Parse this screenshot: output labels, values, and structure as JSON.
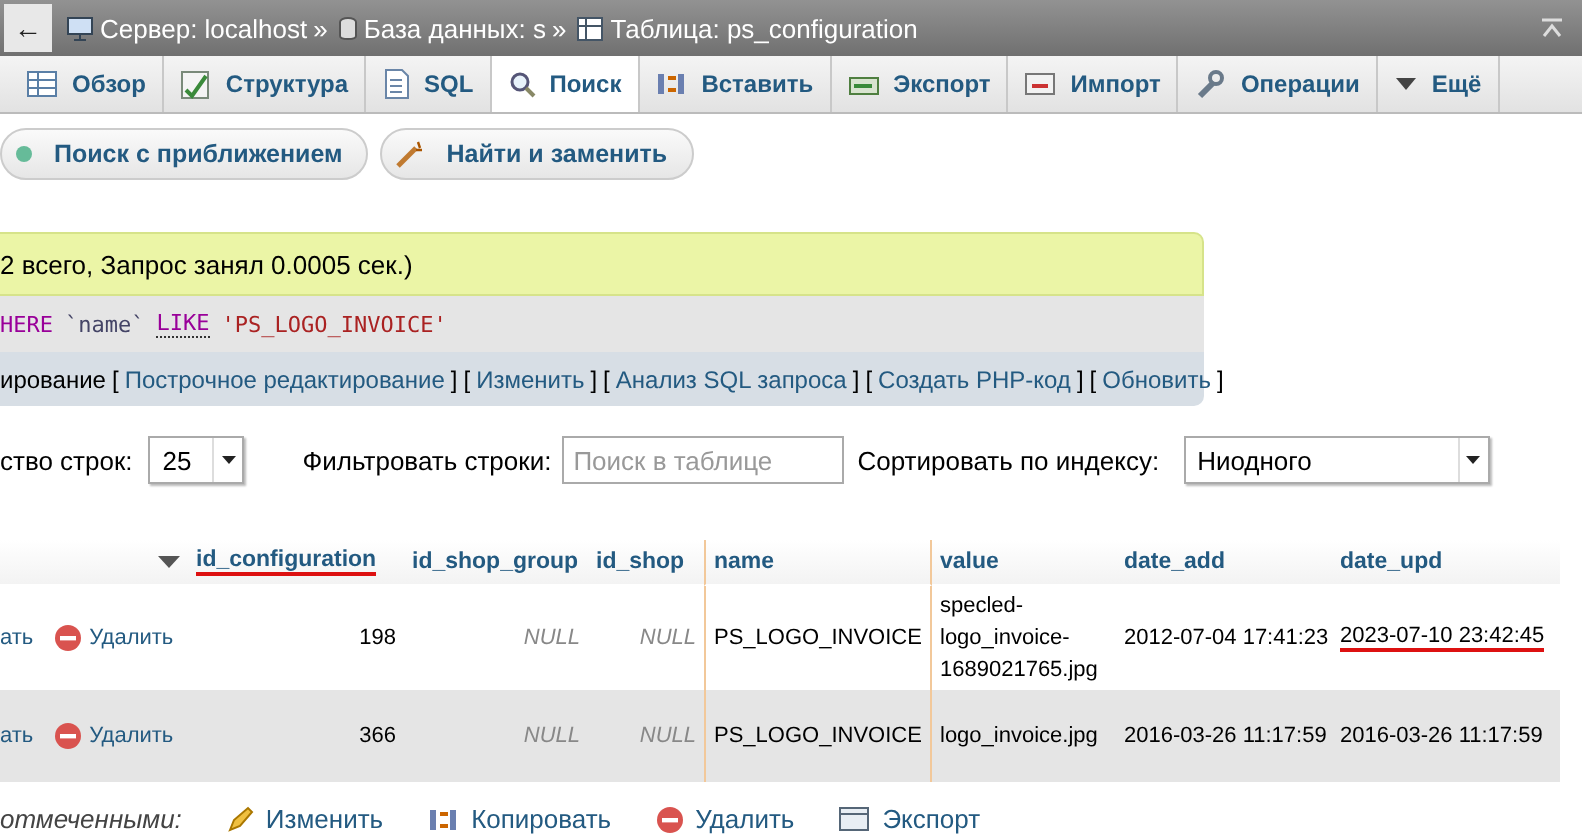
{
  "breadcrumb": {
    "back": "←",
    "items": [
      {
        "label": "Сервер: localhost",
        "separator": "»"
      },
      {
        "label": "База данных: s",
        "separator": "»"
      },
      {
        "label": "Таблица: ps_configuration"
      }
    ]
  },
  "tabs": [
    {
      "label": "Обзор",
      "selected": false
    },
    {
      "label": "Структура",
      "selected": false
    },
    {
      "label": "SQL",
      "selected": false
    },
    {
      "label": "Поиск",
      "selected": true
    },
    {
      "label": "Вставить",
      "selected": false
    },
    {
      "label": "Экспорт",
      "selected": false
    },
    {
      "label": "Импорт",
      "selected": false
    },
    {
      "label": "Операции",
      "selected": false
    },
    {
      "label": "Ещё",
      "selected": false
    }
  ],
  "subnav": [
    "Поиск с приближением",
    "Найти и заменить"
  ],
  "result": {
    "status": "2 всего, Запрос занял 0.0005 сек.)",
    "sql": [
      {
        "kind": "keyword",
        "text": "HERE"
      },
      {
        "kind": "identifier",
        "text": "`name`"
      },
      {
        "kind": "operator",
        "text": "LIKE"
      },
      {
        "kind": "string",
        "text": "'PS_LOGO_INVOICE'"
      }
    ],
    "links_prefix": "ирование",
    "links": [
      {
        "open": "[",
        "label": "Построчное редактирование",
        "close": "]"
      },
      {
        "open": "[",
        "label": "Изменить",
        "close": "]"
      },
      {
        "open": "[",
        "label": "Анализ SQL запроса",
        "close": "]"
      },
      {
        "open": "[",
        "label": "Создать PHP-код",
        "close": "]"
      },
      {
        "open": "[",
        "label": "Обновить",
        "close": "]"
      }
    ]
  },
  "controls": {
    "rows_label": "ство строк:",
    "rows_value": "25",
    "filter_label": "Фильтровать строки:",
    "filter_placeholder": "Поиск в таблице",
    "sort_label": "Сортировать по индексу:",
    "sort_value": "Ниодного"
  },
  "table": {
    "columns": [
      {
        "label": "id_configuration",
        "marked": true
      },
      {
        "label": "id_shop_group",
        "marked": false
      },
      {
        "label": "id_shop",
        "marked": false
      },
      {
        "label": "name",
        "marked": false
      },
      {
        "label": "value",
        "marked": false
      },
      {
        "label": "date_add",
        "marked": false
      },
      {
        "label": "date_upd",
        "marked": false
      }
    ],
    "rows": [
      {
        "actions": [
          "ать",
          "Удалить"
        ],
        "cells": [
          {
            "kind": "number",
            "text": "198",
            "marked": false
          },
          {
            "kind": "null",
            "text": "NULL",
            "marked": false
          },
          {
            "kind": "null",
            "text": "NULL",
            "marked": false
          },
          {
            "kind": "text",
            "text": "PS_LOGO_INVOICE",
            "marked": false
          },
          {
            "kind": "text",
            "text": "specled-logo_invoice-1689021765.jpg",
            "marked": false
          },
          {
            "kind": "text",
            "text": "2012-07-04 17:41:23",
            "marked": false
          },
          {
            "kind": "text",
            "text": "2023-07-10 23:42:45",
            "marked": true
          }
        ]
      },
      {
        "actions": [
          "ать",
          "Удалить"
        ],
        "cells": [
          {
            "kind": "number",
            "text": "366",
            "marked": false
          },
          {
            "kind": "null",
            "text": "NULL",
            "marked": false
          },
          {
            "kind": "null",
            "text": "NULL",
            "marked": false
          },
          {
            "kind": "text",
            "text": "PS_LOGO_INVOICE",
            "marked": false
          },
          {
            "kind": "text",
            "text": "logo_invoice.jpg",
            "marked": false
          },
          {
            "kind": "text",
            "text": "2016-03-26 11:17:59",
            "marked": false
          },
          {
            "kind": "text",
            "text": "2016-03-26 11:17:59",
            "marked": false
          }
        ]
      }
    ]
  },
  "bulk": {
    "label": "отмеченными:",
    "actions": [
      "Изменить",
      "Копировать",
      "Удалить",
      "Экспорт"
    ]
  }
}
